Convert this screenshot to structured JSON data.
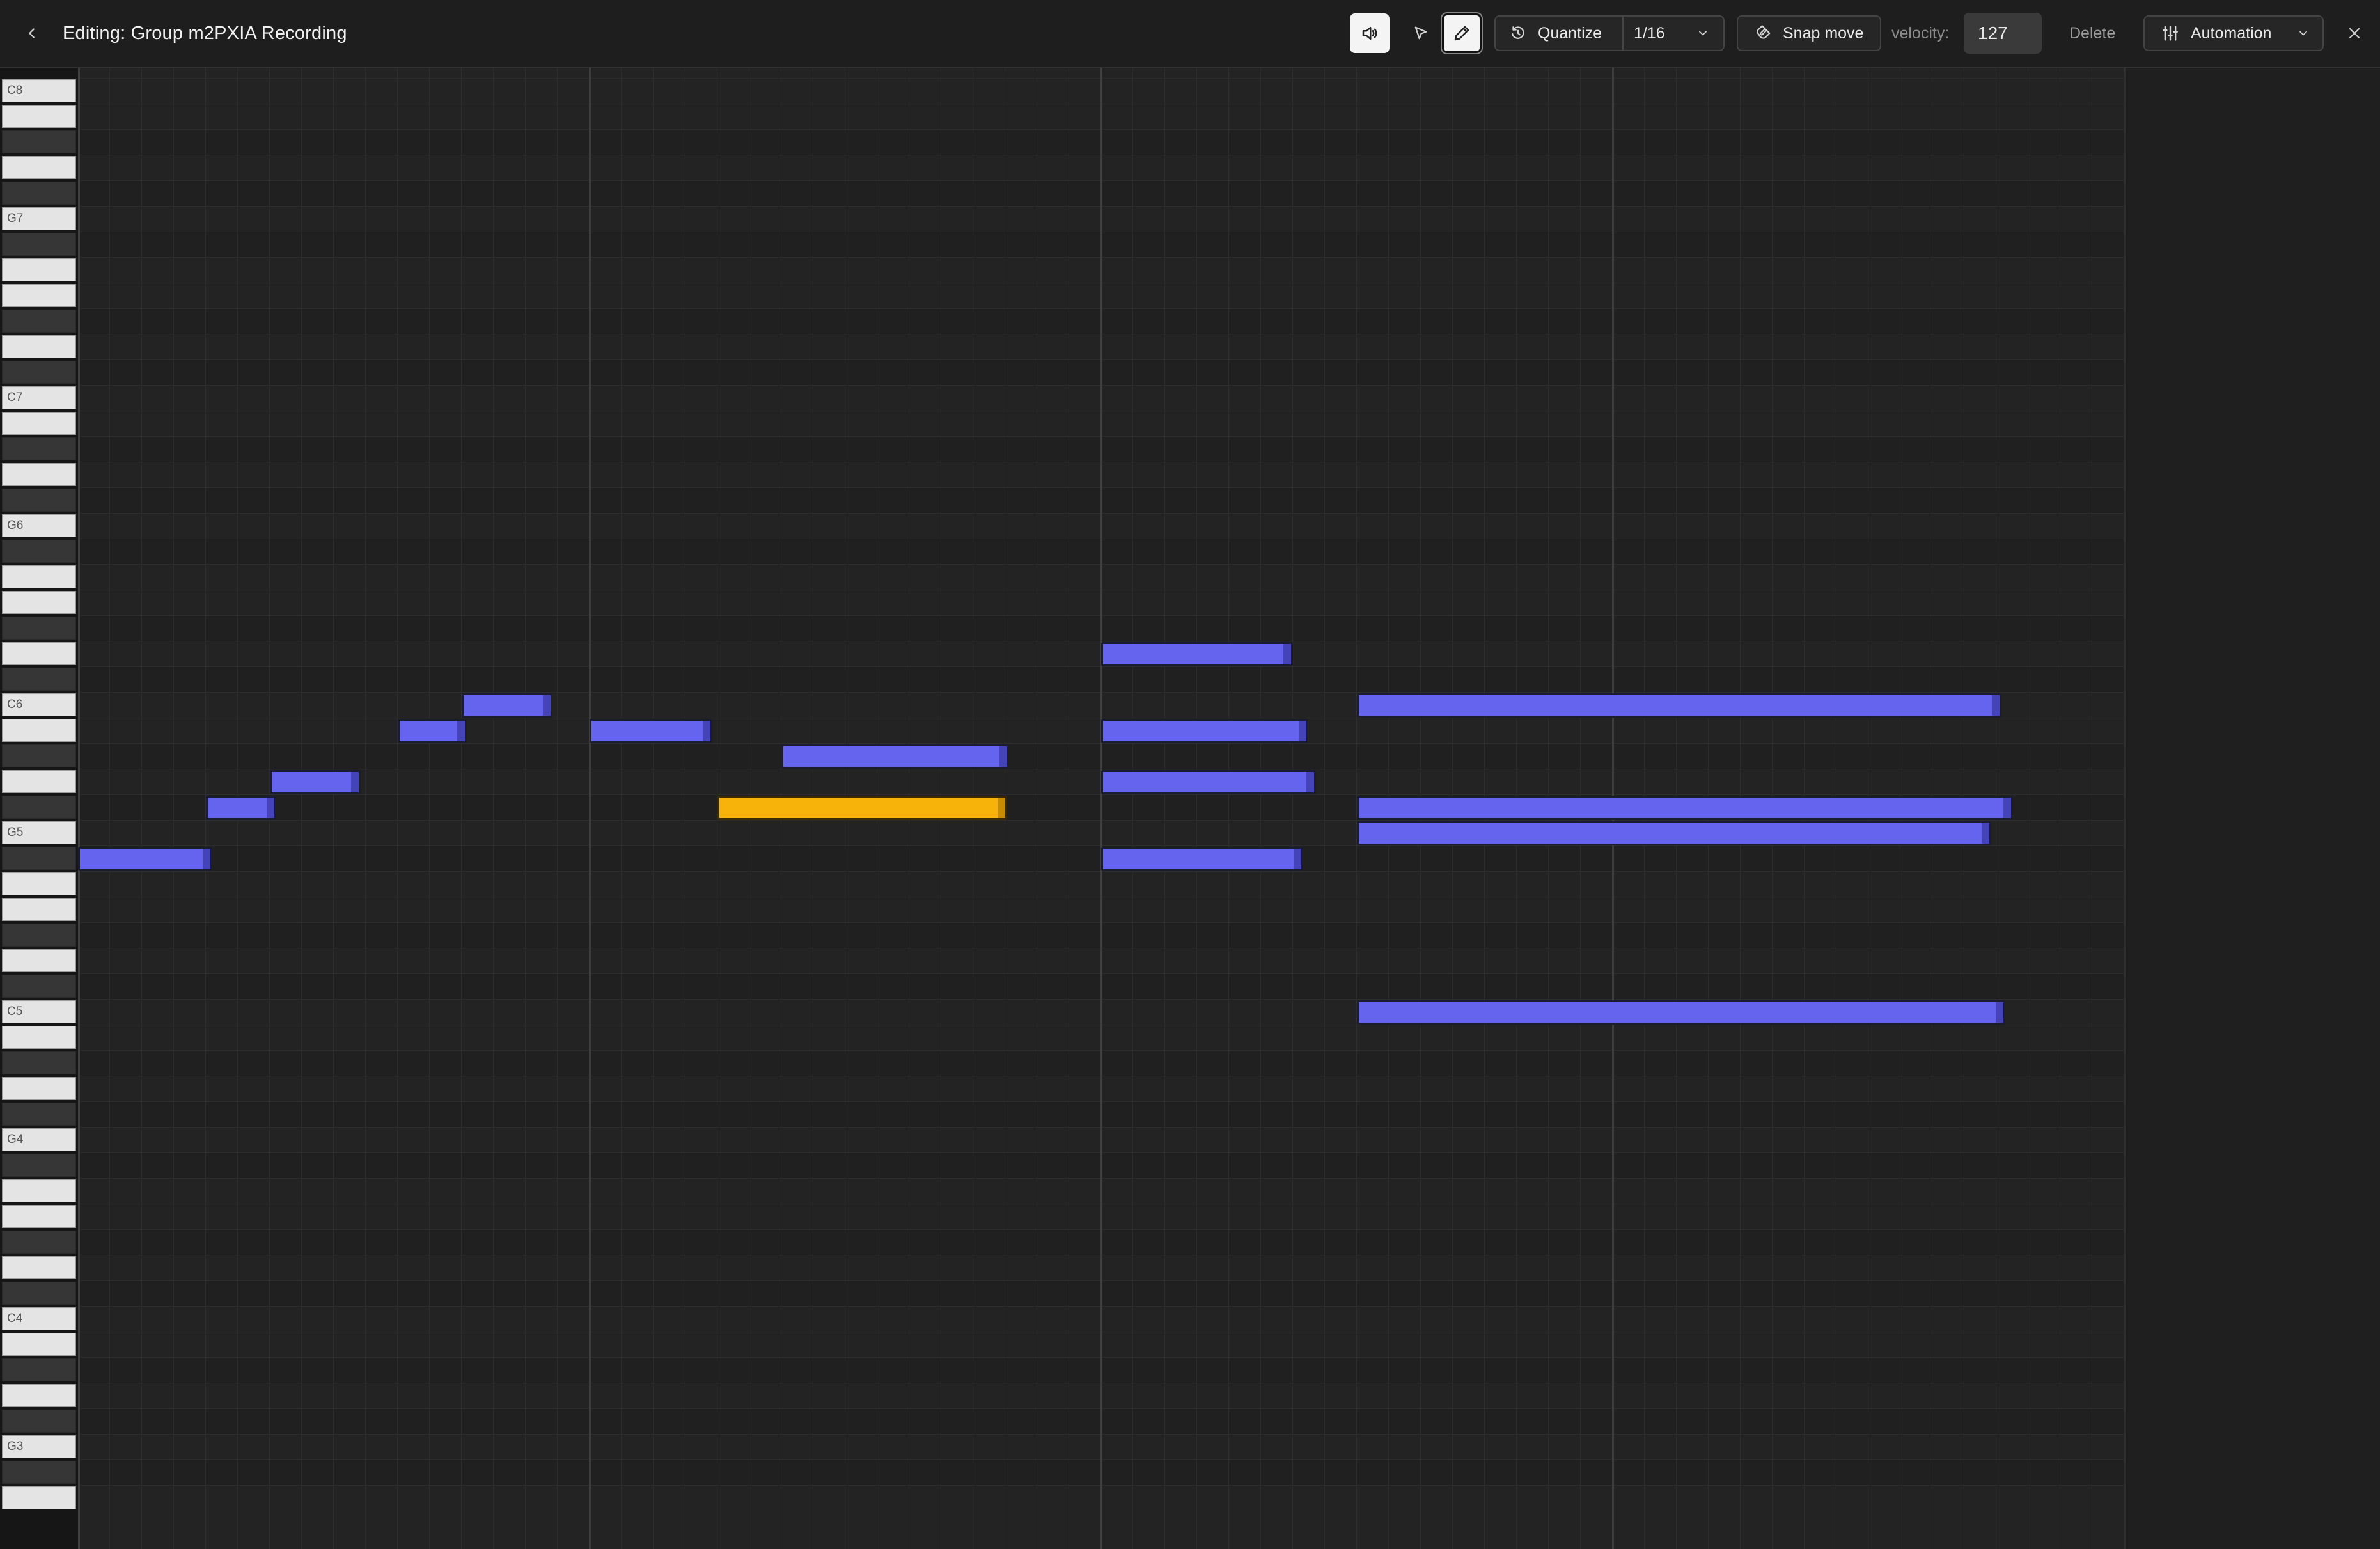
{
  "header": {
    "title": "Editing: Group m2PXIA Recording",
    "quantize_label": "Quantize",
    "quantize_value": "1/16",
    "snap_label": "Snap move",
    "velocity_label": "velocity:",
    "velocity_value": "127",
    "delete_label": "Delete",
    "automation_label": "Automation"
  },
  "icons": {
    "back": "chevron-left-icon",
    "speaker": "speaker-icon",
    "select": "pointer-icon",
    "pencil": "pencil-icon",
    "quantize": "quantize-icon",
    "snap": "magnet-icon",
    "automation": "sliders-icon",
    "close": "close-icon"
  },
  "colors": {
    "note": "#6464ee",
    "note_selected": "#f7b30a",
    "background": "#222222"
  },
  "piano_roll": {
    "top_note": "C8",
    "bottom_note": "F3",
    "octave_labels": [
      "C8",
      "G7",
      "C7",
      "G6",
      "C6",
      "G5",
      "C5",
      "G4",
      "C4",
      "G3"
    ]
  },
  "notes": [
    {
      "pitch": "F#5",
      "selected": false
    },
    {
      "pitch": "G#5",
      "selected": false
    },
    {
      "pitch": "A5",
      "selected": false
    },
    {
      "pitch": "B5",
      "selected": false
    },
    {
      "pitch": "C6",
      "selected": false
    },
    {
      "pitch": "B5",
      "selected": false
    },
    {
      "pitch": "A#5",
      "selected": false
    },
    {
      "pitch": "B5",
      "selected": false
    },
    {
      "pitch": "G#5",
      "selected": true
    },
    {
      "pitch": "D6",
      "selected": false
    },
    {
      "pitch": "B5",
      "selected": false
    },
    {
      "pitch": "A5",
      "selected": false
    },
    {
      "pitch": "F#5",
      "selected": false
    },
    {
      "pitch": "C6",
      "selected": false
    },
    {
      "pitch": "G5",
      "selected": false
    },
    {
      "pitch": "G#5",
      "selected": false
    },
    {
      "pitch": "C5",
      "selected": false
    }
  ]
}
